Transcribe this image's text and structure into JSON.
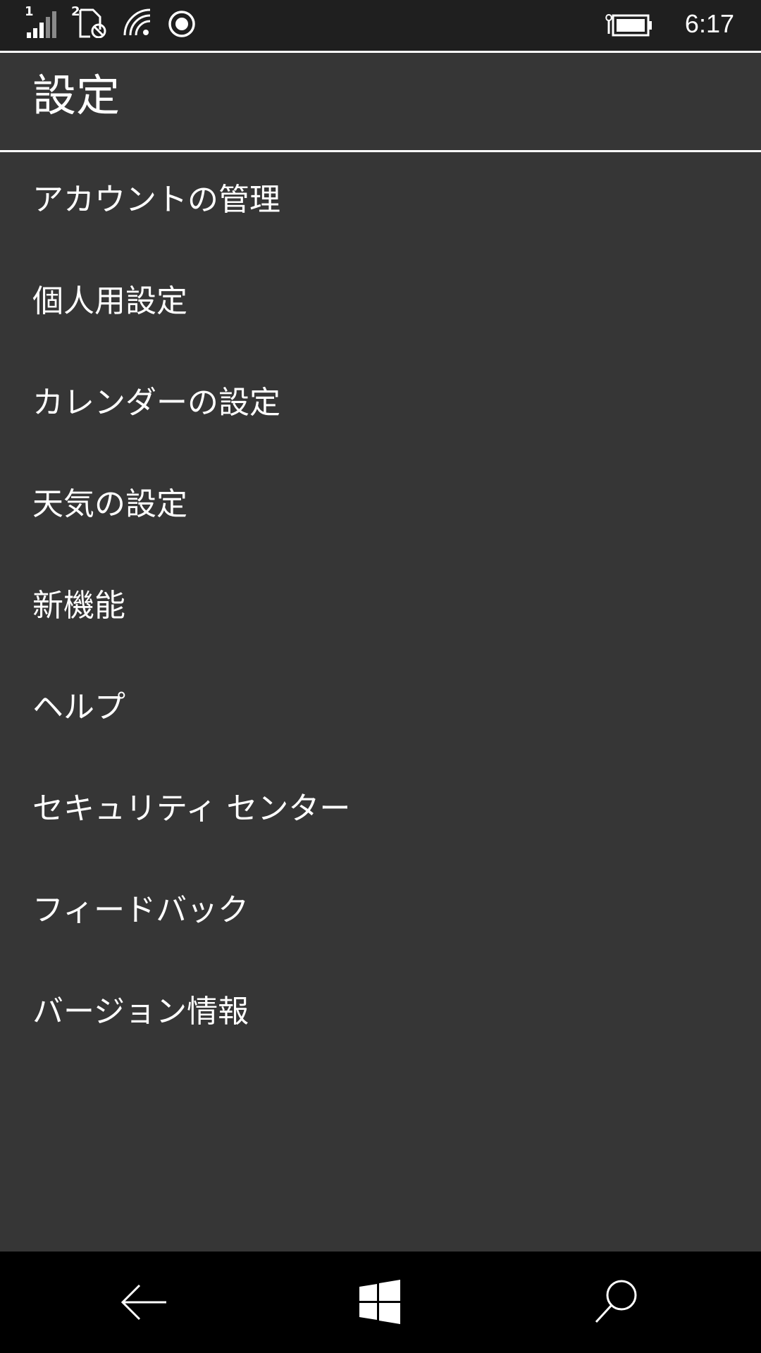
{
  "status_bar": {
    "sim1_label": "1",
    "sim2_label": "2",
    "time": "6:17",
    "icons": [
      "signal-bars-icon",
      "sim-blocked-icon",
      "wifi-icon",
      "location-ring-icon",
      "battery-charging-icon"
    ]
  },
  "header": {
    "title": "設定"
  },
  "menu": {
    "items": [
      {
        "label": "アカウントの管理"
      },
      {
        "label": "個人用設定"
      },
      {
        "label": "カレンダーの設定"
      },
      {
        "label": "天気の設定"
      },
      {
        "label": "新機能"
      },
      {
        "label": "ヘルプ"
      },
      {
        "label": "セキュリティ センター"
      },
      {
        "label": "フィードバック"
      },
      {
        "label": "バージョン情報"
      }
    ]
  },
  "nav_bar": {
    "icons": [
      "back-arrow-icon",
      "windows-logo-icon",
      "search-icon"
    ]
  },
  "colors": {
    "status_bg": "#1f1f1f",
    "content_bg": "#363636",
    "nav_bg": "#000000",
    "text": "#ffffff"
  }
}
